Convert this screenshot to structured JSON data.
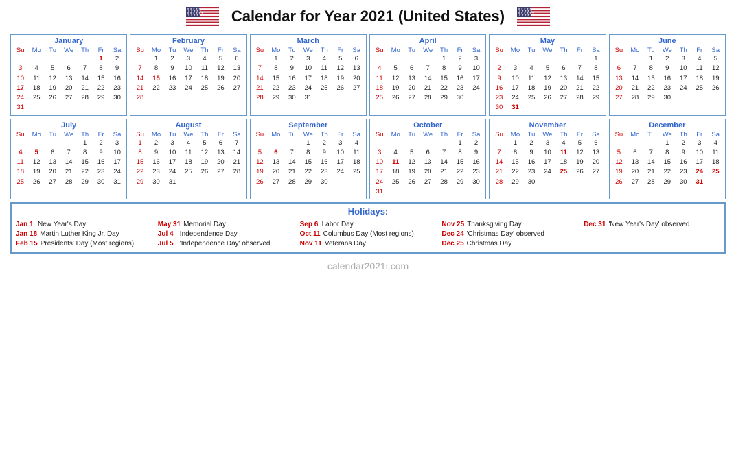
{
  "title": "Calendar for Year 2021 (United States)",
  "footer": "calendar2021i.com",
  "months": [
    {
      "name": "January",
      "days_header": [
        "Su",
        "Mo",
        "Tu",
        "We",
        "Th",
        "Fr",
        "Sa"
      ],
      "weeks": [
        [
          "",
          "",
          "",
          "",
          "",
          "1",
          "2"
        ],
        [
          "3",
          "4",
          "5",
          "6",
          "7",
          "8",
          "9"
        ],
        [
          "10",
          "11",
          "12",
          "13",
          "14",
          "15",
          "16"
        ],
        [
          "17",
          "18",
          "19",
          "20",
          "21",
          "22",
          "23"
        ],
        [
          "24",
          "25",
          "26",
          "27",
          "28",
          "29",
          "30"
        ],
        [
          "31",
          "",
          "",
          "",
          "",
          "",
          ""
        ]
      ],
      "red_days": [
        "1",
        "17"
      ],
      "sun_col": [
        0
      ]
    },
    {
      "name": "February",
      "days_header": [
        "Su",
        "Mo",
        "Tu",
        "We",
        "Th",
        "Fr",
        "Sa"
      ],
      "weeks": [
        [
          "",
          "1",
          "2",
          "3",
          "4",
          "5",
          "6"
        ],
        [
          "7",
          "8",
          "9",
          "10",
          "11",
          "12",
          "13"
        ],
        [
          "14",
          "15",
          "16",
          "17",
          "18",
          "19",
          "20"
        ],
        [
          "21",
          "22",
          "23",
          "24",
          "25",
          "26",
          "27"
        ],
        [
          "28",
          "",
          "",
          "",
          "",
          "",
          ""
        ]
      ],
      "red_days": [
        "15"
      ],
      "sun_col": [
        0
      ]
    },
    {
      "name": "March",
      "days_header": [
        "Su",
        "Mo",
        "Tu",
        "We",
        "Th",
        "Fr",
        "Sa"
      ],
      "weeks": [
        [
          "",
          "1",
          "2",
          "3",
          "4",
          "5",
          "6"
        ],
        [
          "7",
          "8",
          "9",
          "10",
          "11",
          "12",
          "13"
        ],
        [
          "14",
          "15",
          "16",
          "17",
          "18",
          "19",
          "20"
        ],
        [
          "21",
          "22",
          "23",
          "24",
          "25",
          "26",
          "27"
        ],
        [
          "28",
          "29",
          "30",
          "31",
          "",
          "",
          ""
        ]
      ],
      "red_days": [],
      "sun_col": [
        0
      ]
    },
    {
      "name": "April",
      "days_header": [
        "Su",
        "Mo",
        "Tu",
        "We",
        "Th",
        "Fr",
        "Sa"
      ],
      "weeks": [
        [
          "",
          "",
          "",
          "",
          "1",
          "2",
          "3"
        ],
        [
          "4",
          "5",
          "6",
          "7",
          "8",
          "9",
          "10"
        ],
        [
          "11",
          "12",
          "13",
          "14",
          "15",
          "16",
          "17"
        ],
        [
          "18",
          "19",
          "20",
          "21",
          "22",
          "23",
          "24"
        ],
        [
          "25",
          "26",
          "27",
          "28",
          "29",
          "30",
          ""
        ]
      ],
      "red_days": [],
      "sun_col": [
        0
      ]
    },
    {
      "name": "May",
      "days_header": [
        "Su",
        "Mo",
        "Tu",
        "We",
        "Th",
        "Fr",
        "Sa"
      ],
      "weeks": [
        [
          "",
          "",
          "",
          "",
          "",
          "",
          "1"
        ],
        [
          "2",
          "3",
          "4",
          "5",
          "6",
          "7",
          "8"
        ],
        [
          "9",
          "10",
          "11",
          "12",
          "13",
          "14",
          "15"
        ],
        [
          "16",
          "17",
          "18",
          "19",
          "20",
          "21",
          "22"
        ],
        [
          "23",
          "24",
          "25",
          "26",
          "27",
          "28",
          "29"
        ],
        [
          "30",
          "31",
          "",
          "",
          "",
          "",
          ""
        ]
      ],
      "red_days": [
        "31"
      ],
      "sun_col": [
        0
      ]
    },
    {
      "name": "June",
      "days_header": [
        "Su",
        "Mo",
        "Tu",
        "We",
        "Th",
        "Fr",
        "Sa"
      ],
      "weeks": [
        [
          "",
          "",
          "1",
          "2",
          "3",
          "4",
          "5"
        ],
        [
          "6",
          "7",
          "8",
          "9",
          "10",
          "11",
          "12"
        ],
        [
          "13",
          "14",
          "15",
          "16",
          "17",
          "18",
          "19"
        ],
        [
          "20",
          "21",
          "22",
          "23",
          "24",
          "25",
          "26"
        ],
        [
          "27",
          "28",
          "29",
          "30",
          "",
          "",
          ""
        ]
      ],
      "red_days": [],
      "sun_col": [
        0
      ]
    },
    {
      "name": "July",
      "days_header": [
        "Su",
        "Mo",
        "Tu",
        "We",
        "Th",
        "Fr",
        "Sa"
      ],
      "weeks": [
        [
          "",
          "",
          "",
          "",
          "1",
          "2",
          "3"
        ],
        [
          "4",
          "5",
          "6",
          "7",
          "8",
          "9",
          "10"
        ],
        [
          "11",
          "12",
          "13",
          "14",
          "15",
          "16",
          "17"
        ],
        [
          "18",
          "19",
          "20",
          "21",
          "22",
          "23",
          "24"
        ],
        [
          "25",
          "26",
          "27",
          "28",
          "29",
          "30",
          "31"
        ]
      ],
      "red_days": [
        "4",
        "5"
      ],
      "sun_col": [
        0
      ]
    },
    {
      "name": "August",
      "days_header": [
        "Su",
        "Mo",
        "Tu",
        "We",
        "Th",
        "Fr",
        "Sa"
      ],
      "weeks": [
        [
          "1",
          "2",
          "3",
          "4",
          "5",
          "6",
          "7"
        ],
        [
          "8",
          "9",
          "10",
          "11",
          "12",
          "13",
          "14"
        ],
        [
          "15",
          "16",
          "17",
          "18",
          "19",
          "20",
          "21"
        ],
        [
          "22",
          "23",
          "24",
          "25",
          "26",
          "27",
          "28"
        ],
        [
          "29",
          "30",
          "31",
          "",
          "",
          "",
          ""
        ]
      ],
      "red_days": [],
      "sun_col": [
        0
      ]
    },
    {
      "name": "September",
      "days_header": [
        "Su",
        "Mo",
        "Tu",
        "We",
        "Th",
        "Fr",
        "Sa"
      ],
      "weeks": [
        [
          "",
          "",
          "",
          "1",
          "2",
          "3",
          "4"
        ],
        [
          "5",
          "6",
          "7",
          "8",
          "9",
          "10",
          "11"
        ],
        [
          "12",
          "13",
          "14",
          "15",
          "16",
          "17",
          "18"
        ],
        [
          "19",
          "20",
          "21",
          "22",
          "23",
          "24",
          "25"
        ],
        [
          "26",
          "27",
          "28",
          "29",
          "30",
          "",
          ""
        ]
      ],
      "red_days": [
        "6"
      ],
      "sun_col": [
        0
      ]
    },
    {
      "name": "October",
      "days_header": [
        "Su",
        "Mo",
        "Tu",
        "We",
        "Th",
        "Fr",
        "Sa"
      ],
      "weeks": [
        [
          "",
          "",
          "",
          "",
          "",
          "1",
          "2"
        ],
        [
          "3",
          "4",
          "5",
          "6",
          "7",
          "8",
          "9"
        ],
        [
          "10",
          "11",
          "12",
          "13",
          "14",
          "15",
          "16"
        ],
        [
          "17",
          "18",
          "19",
          "20",
          "21",
          "22",
          "23"
        ],
        [
          "24",
          "25",
          "26",
          "27",
          "28",
          "29",
          "30"
        ],
        [
          "31",
          "",
          "",
          "",
          "",
          "",
          ""
        ]
      ],
      "red_days": [
        "11"
      ],
      "sun_col": [
        0
      ]
    },
    {
      "name": "November",
      "days_header": [
        "Su",
        "Mo",
        "Tu",
        "We",
        "Th",
        "Fr",
        "Sa"
      ],
      "weeks": [
        [
          "",
          "1",
          "2",
          "3",
          "4",
          "5",
          "6"
        ],
        [
          "7",
          "8",
          "9",
          "10",
          "11",
          "12",
          "13"
        ],
        [
          "14",
          "15",
          "16",
          "17",
          "18",
          "19",
          "20"
        ],
        [
          "21",
          "22",
          "23",
          "24",
          "25",
          "26",
          "27"
        ],
        [
          "28",
          "29",
          "30",
          "",
          "",
          "",
          ""
        ]
      ],
      "red_days": [
        "11",
        "25"
      ],
      "sun_col": [
        0
      ]
    },
    {
      "name": "December",
      "days_header": [
        "Su",
        "Mo",
        "Tu",
        "We",
        "Th",
        "Fr",
        "Sa"
      ],
      "weeks": [
        [
          "",
          "",
          "",
          "1",
          "2",
          "3",
          "4"
        ],
        [
          "5",
          "6",
          "7",
          "8",
          "9",
          "10",
          "11"
        ],
        [
          "12",
          "13",
          "14",
          "15",
          "16",
          "17",
          "18"
        ],
        [
          "19",
          "20",
          "21",
          "22",
          "23",
          "24",
          "25"
        ],
        [
          "26",
          "27",
          "28",
          "29",
          "30",
          "31",
          ""
        ]
      ],
      "red_days": [
        "24",
        "25",
        "31"
      ],
      "sun_col": [
        0
      ]
    }
  ],
  "holidays_title": "Holidays:",
  "holiday_columns": [
    [
      {
        "date": "Jan 1",
        "name": "New Year's Day"
      },
      {
        "date": "Jan 18",
        "name": "Martin Luther King Jr. Day"
      },
      {
        "date": "Feb 15",
        "name": "Presidents' Day (Most regions)"
      }
    ],
    [
      {
        "date": "May 31",
        "name": "Memorial Day"
      },
      {
        "date": "Jul 4",
        "name": "Independence Day"
      },
      {
        "date": "Jul 5",
        "name": "'Independence Day' observed"
      }
    ],
    [
      {
        "date": "Sep 6",
        "name": "Labor Day"
      },
      {
        "date": "Oct 11",
        "name": "Columbus Day (Most regions)"
      },
      {
        "date": "Nov 11",
        "name": "Veterans Day"
      }
    ],
    [
      {
        "date": "Nov 25",
        "name": "Thanksgiving Day"
      },
      {
        "date": "Dec 24",
        "name": "'Christmas Day' observed"
      },
      {
        "date": "Dec 25",
        "name": "Christmas Day"
      }
    ],
    [
      {
        "date": "Dec 31",
        "name": "'New Year's Day' observed"
      }
    ]
  ]
}
